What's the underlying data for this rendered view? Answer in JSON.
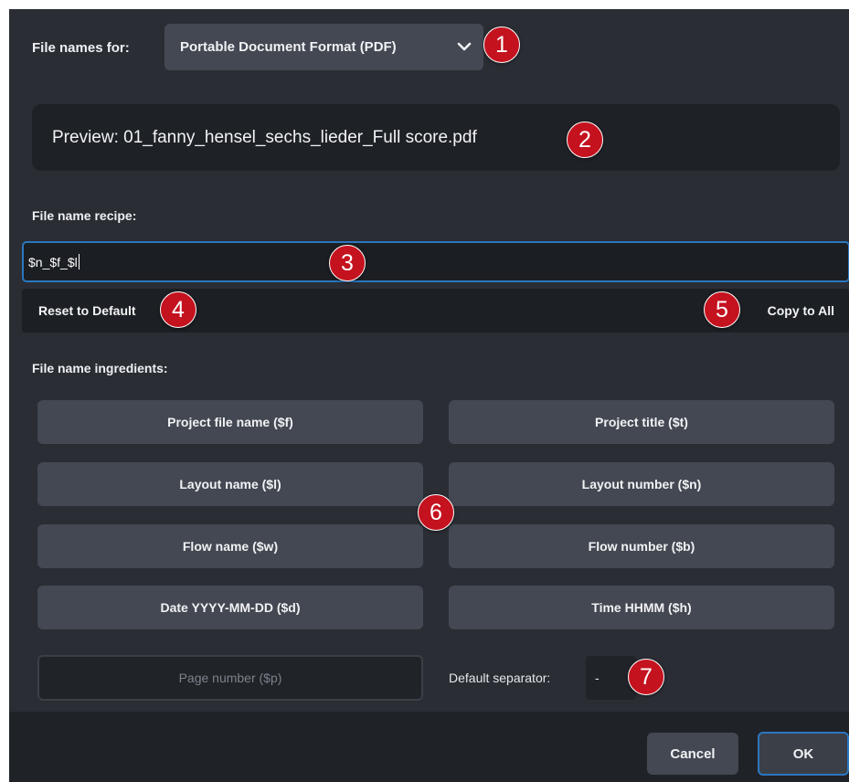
{
  "format": {
    "label": "File names for:",
    "selected": "Portable Document Format (PDF)"
  },
  "preview": {
    "text": "Preview: 01_fanny_hensel_sechs_lieder_Full score.pdf"
  },
  "recipe": {
    "label": "File name recipe:",
    "value": "$n_$f_$l"
  },
  "actions": {
    "reset": "Reset to Default",
    "copy_all": "Copy to All"
  },
  "ingredients": {
    "label": "File name ingredients:",
    "items": [
      "Project file name ($f)",
      "Project title ($t)",
      "Layout name ($l)",
      "Layout number ($n)",
      "Flow name ($w)",
      "Flow number ($b)",
      "Date YYYY-MM-DD ($d)",
      "Time HHMM ($h)"
    ],
    "page_number": "Page number ($p)"
  },
  "separator": {
    "label": "Default separator:",
    "value": "-"
  },
  "footer": {
    "cancel": "Cancel",
    "ok": "OK"
  },
  "callouts": [
    "1",
    "2",
    "3",
    "4",
    "5",
    "6",
    "7"
  ],
  "colors": {
    "dialog_bg": "#2a2d34",
    "button_bg": "#434852",
    "focus_accent": "#2b77bf",
    "callout_red": "#c4121f"
  }
}
